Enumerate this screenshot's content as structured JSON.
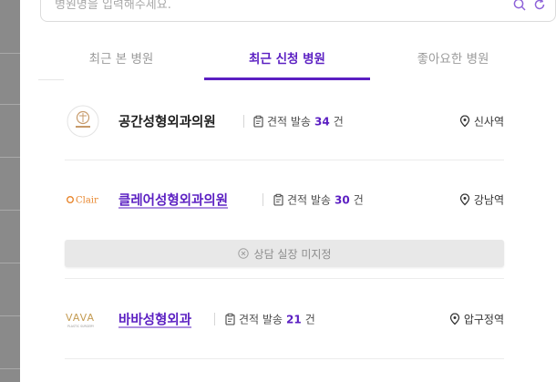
{
  "search": {
    "placeholder": "병원명을 입력해주세요."
  },
  "tabs": [
    {
      "label": "최근 본 병원",
      "active": false
    },
    {
      "label": "최근 신청 병원",
      "active": true
    },
    {
      "label": "좋아요한 병원",
      "active": false
    }
  ],
  "hospitals": [
    {
      "name": "공간성형외과의원",
      "quote_prefix": "견적 발송",
      "quote_count": "34",
      "quote_unit": "건",
      "station": "신사역",
      "logo_icon": "gonggan-logo"
    },
    {
      "name": "클레어성형외과의원",
      "quote_prefix": "견적 발송",
      "quote_count": "30",
      "quote_unit": "건",
      "station": "강남역",
      "logo_icon": "clair-logo",
      "logo_text": "Clair"
    },
    {
      "name": "바바성형외과",
      "quote_prefix": "견적 발송",
      "quote_count": "21",
      "quote_unit": "건",
      "station": "압구정역",
      "logo_icon": "vava-logo",
      "logo_text": "VAVA",
      "logo_subtext": "PLASTIC SURGERY"
    }
  ],
  "consult_notice": {
    "label": "상담 실장 미지정",
    "icon": "close-circle-icon"
  },
  "colors": {
    "accent": "#5b1fc2",
    "muted": "#9a9a9a",
    "clair_orange": "#e8872e"
  }
}
